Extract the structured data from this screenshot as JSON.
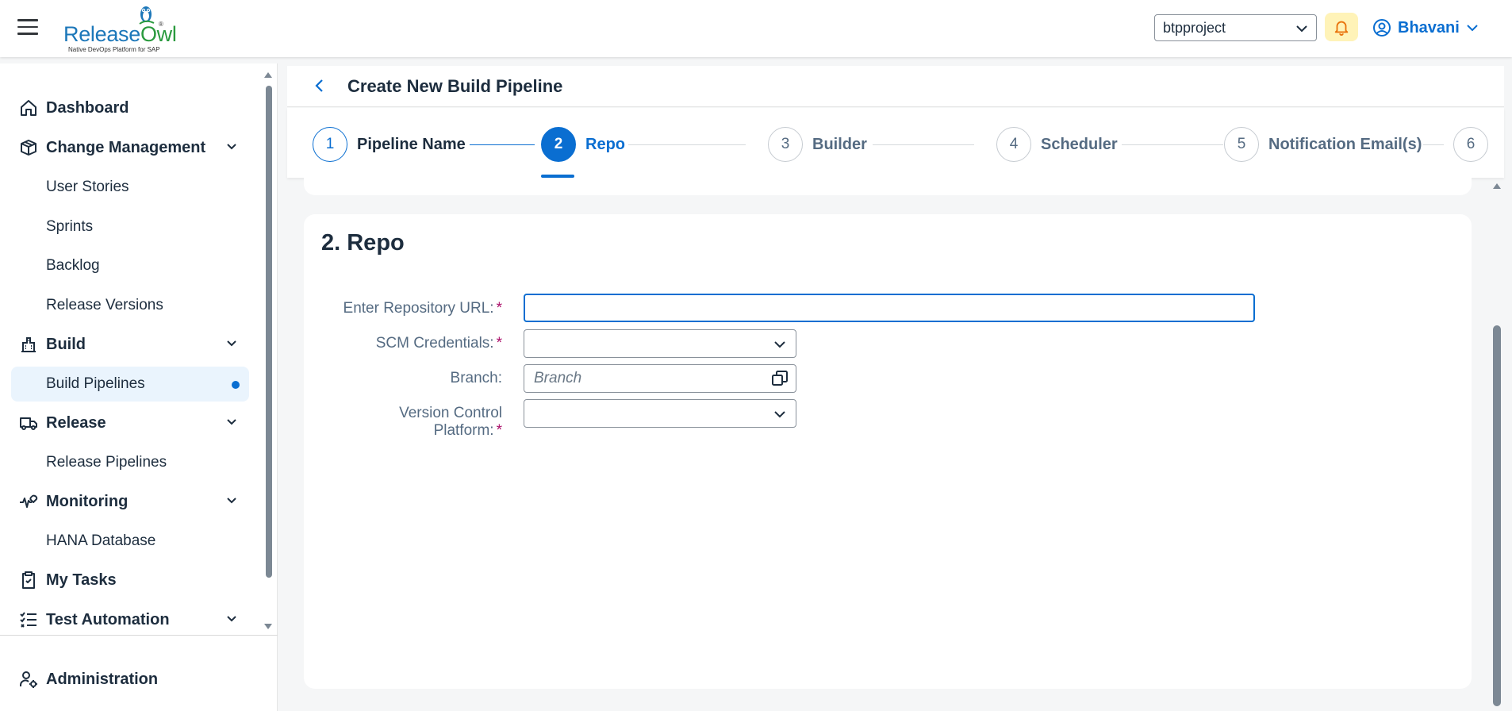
{
  "header": {
    "logo": {
      "brand_part1": "Release",
      "brand_part2": "Owl",
      "tagline": "Native DevOps Platform for SAP",
      "reg_mark": "®"
    },
    "project_selector": {
      "value": "btpproject"
    },
    "user": {
      "name": "Bhavani"
    }
  },
  "sidebar": {
    "items": [
      {
        "label": "Dashboard"
      },
      {
        "label": "Change Management"
      },
      {
        "label": "User Stories"
      },
      {
        "label": "Sprints"
      },
      {
        "label": "Backlog"
      },
      {
        "label": "Release Versions"
      },
      {
        "label": "Build"
      },
      {
        "label": "Build Pipelines"
      },
      {
        "label": "Release"
      },
      {
        "label": "Release Pipelines"
      },
      {
        "label": "Monitoring"
      },
      {
        "label": "HANA Database"
      },
      {
        "label": "My Tasks"
      },
      {
        "label": "Test Automation"
      }
    ],
    "footer": {
      "label": "Administration"
    }
  },
  "page": {
    "title": "Create New Build Pipeline"
  },
  "wizard": {
    "steps": [
      {
        "number": "1",
        "label": "Pipeline Name"
      },
      {
        "number": "2",
        "label": "Repo"
      },
      {
        "number": "3",
        "label": "Builder"
      },
      {
        "number": "4",
        "label": "Scheduler"
      },
      {
        "number": "5",
        "label": "Notification Email(s)"
      },
      {
        "number": "6",
        "label": ""
      }
    ]
  },
  "form": {
    "section_title": "2. Repo",
    "required_marker": "*",
    "repo_url": {
      "label": "Enter Repository URL:",
      "value": ""
    },
    "scm_credentials": {
      "label": "SCM Credentials:",
      "value": ""
    },
    "branch": {
      "label": "Branch:",
      "placeholder": "Branch",
      "value": ""
    },
    "vcs_platform": {
      "label_line1": "Version Control",
      "label_line2": "Platform:",
      "value": ""
    }
  },
  "colors": {
    "accent": "#0a6ed1",
    "required": "#aa0e69",
    "bell_bg": "#fff3b8",
    "active_nav_bg": "#eaf4fd"
  },
  "icons": [
    "menu-icon",
    "owl-logo-icon",
    "chevron-down-icon",
    "bell-icon",
    "user-circle-icon",
    "home-icon",
    "box-icon",
    "building-icon",
    "truck-icon",
    "heart-pulse-icon",
    "clipboard-icon",
    "checklist-icon",
    "user-gear-icon",
    "back-arrow-icon",
    "copy-icon"
  ]
}
